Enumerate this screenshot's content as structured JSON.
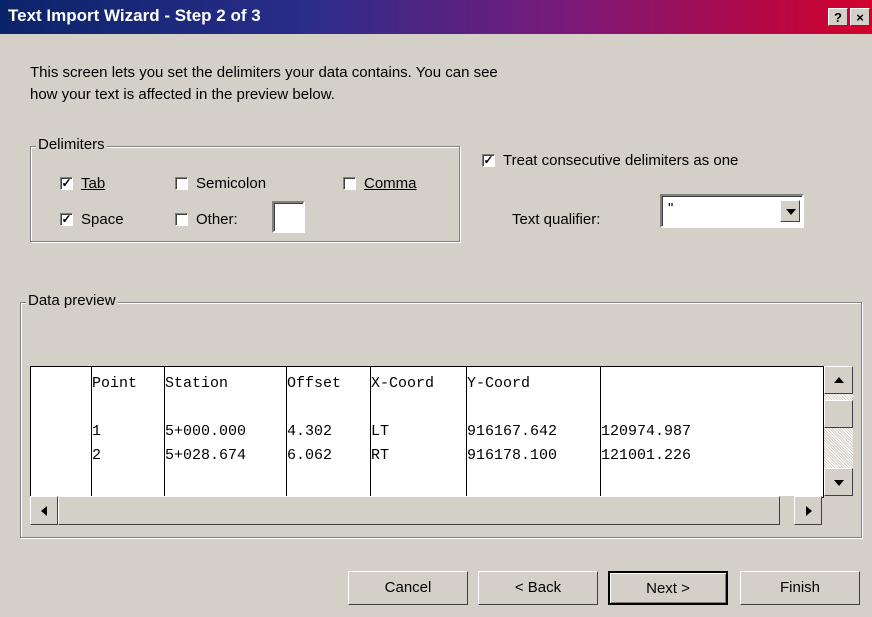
{
  "window": {
    "title": "Text Import Wizard - Step 2 of 3",
    "help_glyph": "?",
    "close_glyph": "×"
  },
  "intro": {
    "line1": "This screen lets you set the delimiters your data contains.  You can see",
    "line2": "how your text is affected in the preview below."
  },
  "delimiters": {
    "legend": "Delimiters",
    "tab": {
      "label": "Tab",
      "checked": true
    },
    "semicolon": {
      "label": "Semicolon",
      "checked": false
    },
    "comma": {
      "label": "Comma",
      "checked": false
    },
    "space": {
      "label": "Space",
      "checked": true
    },
    "other": {
      "label": "Other:",
      "checked": false,
      "value": ""
    }
  },
  "treat_consecutive": {
    "label": "Treat consecutive delimiters as one",
    "checked": true
  },
  "text_qualifier": {
    "label": "Text qualifier:",
    "value": "\""
  },
  "preview": {
    "legend": "Data preview",
    "headers": [
      "Point",
      "Station",
      "Offset",
      "X-Coord",
      "Y-Coord",
      ""
    ],
    "rows": [
      [
        "1",
        "5+000.000",
        "4.302",
        "LT",
        "916167.642",
        "120974.987"
      ],
      [
        "2",
        "5+028.674",
        "6.062",
        "RT",
        "916178.100",
        "121001.226"
      ]
    ]
  },
  "buttons": {
    "cancel": "Cancel",
    "back": "< Back",
    "next": "Next >",
    "finish": "Finish"
  },
  "colors": {
    "dialog": "#d4d0c8",
    "title_start": "#0a246a",
    "title_end": "#d4002a"
  },
  "icons": {
    "check": "check-icon",
    "dropdown": "chevron-down-icon",
    "scroll_up": "arrow-up-icon",
    "scroll_down": "arrow-down-icon",
    "scroll_left": "arrow-left-icon",
    "scroll_right": "arrow-right-icon"
  }
}
